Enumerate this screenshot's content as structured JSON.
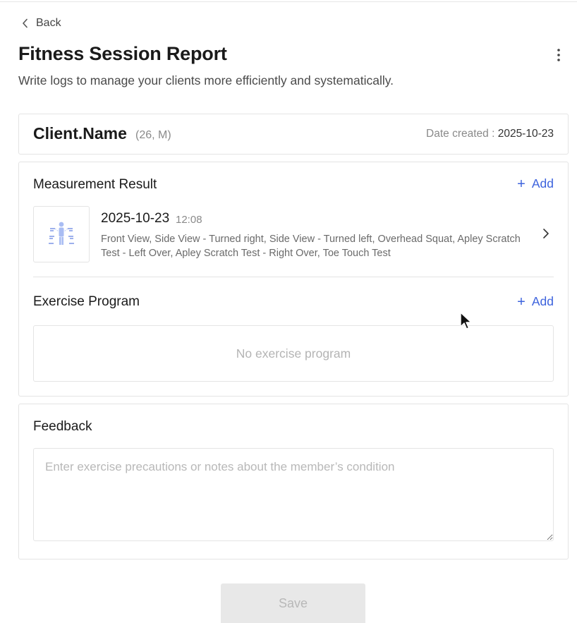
{
  "nav": {
    "back_label": "Back"
  },
  "header": {
    "title": "Fitness Session Report",
    "subtitle": "Write logs to manage your clients more efficiently and systematically."
  },
  "client": {
    "name": "Client.Name",
    "meta": "(26, M)",
    "date_created_label": "Date created :",
    "date_created_value": "2025-10-23"
  },
  "measurement": {
    "title": "Measurement Result",
    "add_label": "Add",
    "items": [
      {
        "date": "2025-10-23",
        "time": "12:08",
        "description": "Front View, Side View - Turned right, Side View - Turned left, Overhead Squat, Apley Scratch Test - Left Over, Apley Scratch Test - Right Over, Toe Touch Test"
      }
    ]
  },
  "exercise": {
    "title": "Exercise Program",
    "add_label": "Add",
    "empty_text": "No exercise program"
  },
  "feedback": {
    "title": "Feedback",
    "placeholder": "Enter exercise precautions or notes about the member’s condition",
    "value": ""
  },
  "actions": {
    "save_label": "Save"
  },
  "colors": {
    "accent": "#3d63dd",
    "disabled_bg": "#e8e8e8",
    "border": "#e4e4e4"
  }
}
